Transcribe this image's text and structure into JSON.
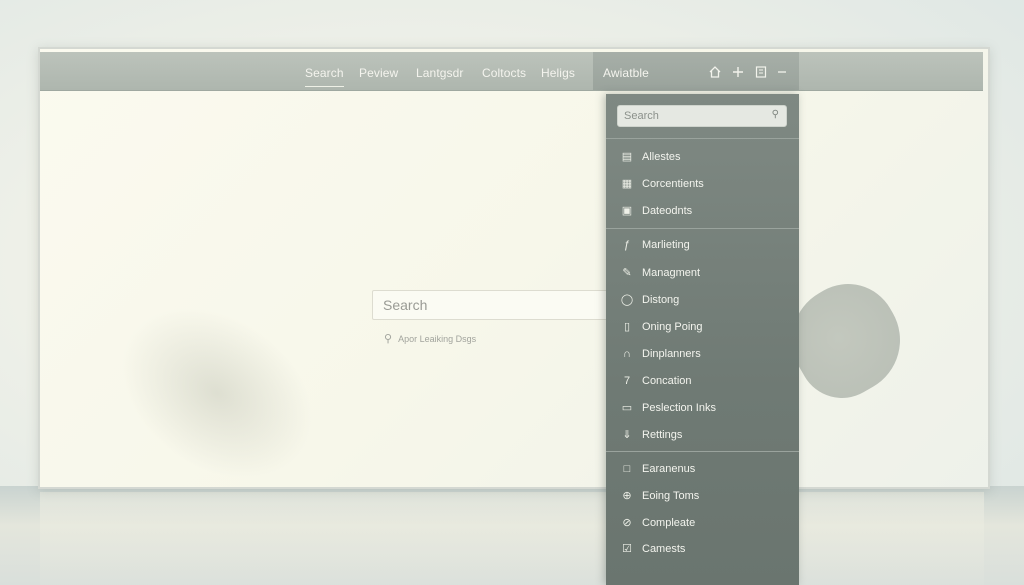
{
  "topnav": {
    "items": [
      {
        "label": "Search",
        "active": true
      },
      {
        "label": "Peview",
        "active": false
      },
      {
        "label": "Lantgsdr",
        "active": false
      },
      {
        "label": "Coltocts",
        "active": false
      },
      {
        "label": "Heligs",
        "active": false
      },
      {
        "label": "Awiatble",
        "active": false
      }
    ],
    "icons": [
      "home-icon",
      "plus-icon",
      "bookmark-icon",
      "minimize-icon"
    ]
  },
  "main": {
    "search_placeholder": "Search",
    "suggestion": "Apor Leaiking Dsgs"
  },
  "panel": {
    "search_placeholder": "Search",
    "groups": [
      [
        {
          "label": "Allestes",
          "icon": "list-icon"
        },
        {
          "label": "Corcentients",
          "icon": "calendar-icon"
        },
        {
          "label": "Dateodnts",
          "icon": "document-icon"
        }
      ],
      [
        {
          "label": "Marlieting",
          "icon": "pen-icon"
        },
        {
          "label": "Managment",
          "icon": "edit-icon"
        },
        {
          "label": "Distong",
          "icon": "coin-icon"
        },
        {
          "label": "Oning Poing",
          "icon": "trash-icon"
        },
        {
          "label": "Dinplanners",
          "icon": "pair-icon"
        },
        {
          "label": "Concation",
          "icon": "seven-icon"
        },
        {
          "label": "Peslection Inks",
          "icon": "card-icon"
        },
        {
          "label": "Rettings",
          "icon": "download-icon"
        }
      ],
      [
        {
          "label": "Earanenus",
          "icon": "folder-icon"
        },
        {
          "label": "Eoing Toms",
          "icon": "globe-icon"
        },
        {
          "label": "Compleate",
          "icon": "tag-icon"
        },
        {
          "label": "Camests",
          "icon": "checkbox-icon"
        }
      ]
    ]
  }
}
